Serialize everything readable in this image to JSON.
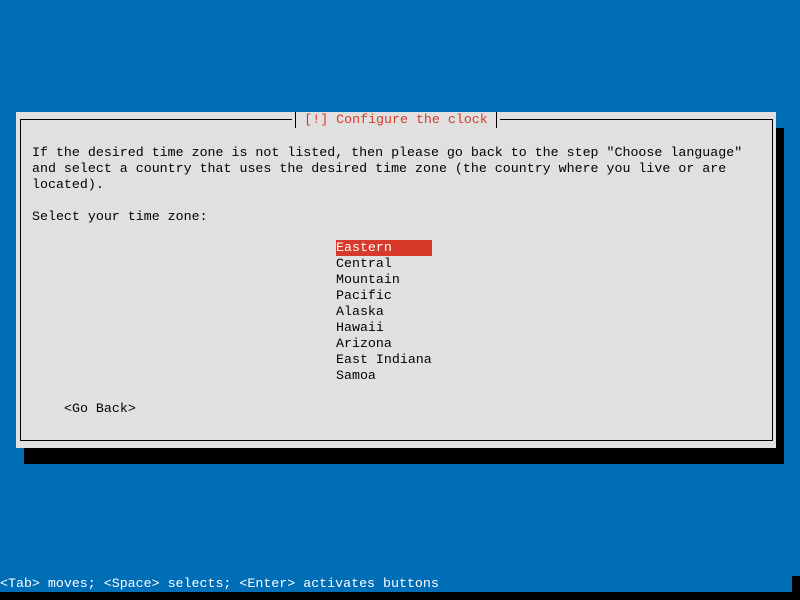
{
  "dialog": {
    "title": "[!] Configure the clock",
    "description": [
      "If the desired time zone is not listed, then please go back to the step \"Choose language\"",
      "and select a country that uses the desired time zone (the country where you live or are",
      "located)."
    ],
    "prompt": "Select your time zone:",
    "timezones": [
      "Eastern",
      "Central",
      "Mountain",
      "Pacific",
      "Alaska",
      "Hawaii",
      "Arizona",
      "East Indiana",
      "Samoa"
    ],
    "selected": "Eastern",
    "go_back_label": "<Go Back>"
  },
  "status_bar": "<Tab> moves; <Space> selects; <Enter> activates buttons",
  "colors": {
    "background": "#006db7",
    "dialog": "#e0e0e0",
    "accent": "#d73a2a"
  }
}
